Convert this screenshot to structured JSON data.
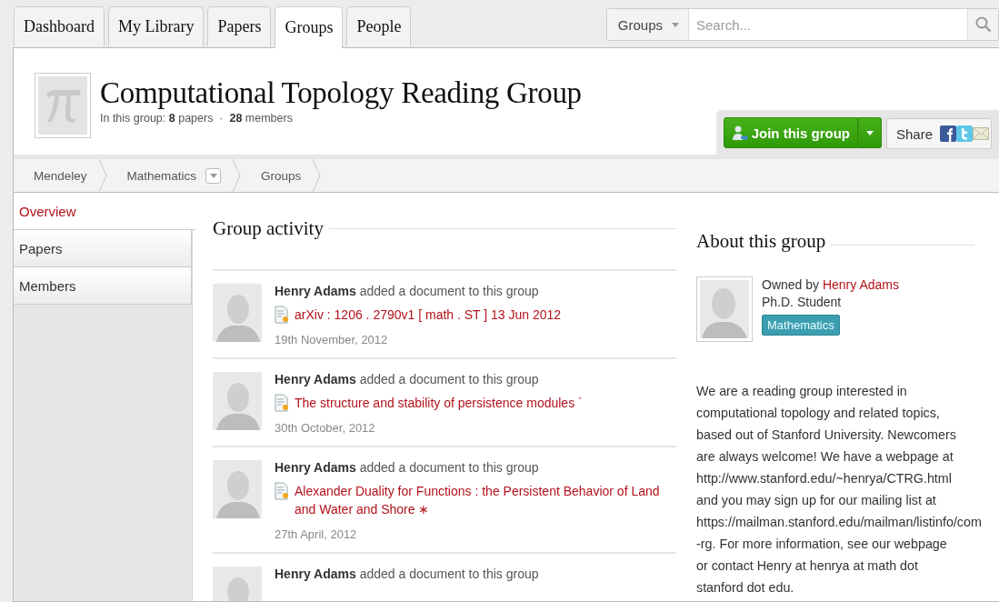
{
  "tabs": [
    {
      "label": "Dashboard",
      "selected": false
    },
    {
      "label": "My Library",
      "selected": false
    },
    {
      "label": "Papers",
      "selected": false
    },
    {
      "label": "Groups",
      "selected": true
    },
    {
      "label": "People",
      "selected": false
    }
  ],
  "search": {
    "scope": "Groups",
    "placeholder": "Search..."
  },
  "group": {
    "title": "Computational Topology Reading Group",
    "stats_prefix": "In this group:",
    "papers_count": "8",
    "papers_label": "papers",
    "separator": "·",
    "members_count": "28",
    "members_label": "members"
  },
  "actions": {
    "join": "Join this group",
    "share": "Share"
  },
  "breadcrumb": [
    {
      "label": "Mendeley",
      "dropdown": false
    },
    {
      "label": "Mathematics",
      "dropdown": true
    },
    {
      "label": "Groups",
      "dropdown": false
    }
  ],
  "sidebar": [
    {
      "label": "Overview",
      "selected": true
    },
    {
      "label": "Papers",
      "selected": false
    },
    {
      "label": "Members",
      "selected": false
    }
  ],
  "activity": {
    "heading": "Group activity",
    "items": [
      {
        "author": "Henry Adams",
        "action": "added a document to this group",
        "document": "arXiv : 1206 . 2790v1 [ math . ST ] 13 Jun 2012",
        "date": "19th November, 2012"
      },
      {
        "author": "Henry Adams",
        "action": "added a document to this group",
        "document": "The structure and stability of persistence modules ´",
        "date": "30th October, 2012"
      },
      {
        "author": "Henry Adams",
        "action": "added a document to this group",
        "document": "Alexander Duality for Functions : the Persistent Behavior of Land and Water and Shore ∗",
        "date": "27th April, 2012"
      },
      {
        "author": "Henry Adams",
        "action": "added a document to this group"
      }
    ]
  },
  "about": {
    "heading": "About this group",
    "owned_prefix": "Owned by",
    "owner": "Henry Adams",
    "role": "Ph.D. Student",
    "tag": "Mathematics",
    "description_lines": [
      "We are a reading group interested in",
      "computational topology and related topics,",
      "based out of Stanford University. Newcomers",
      "are always welcome! We have a webpage at",
      "http://www.stanford.edu/~henrya/CTRG.html",
      "and you may sign up for our mailing list at",
      "https://mailman.stanford.edu/mailman/listinfo/com",
      "-rg. For more information, see our webpage",
      "or contact Henry at henrya at math dot",
      "stanford dot edu."
    ]
  }
}
